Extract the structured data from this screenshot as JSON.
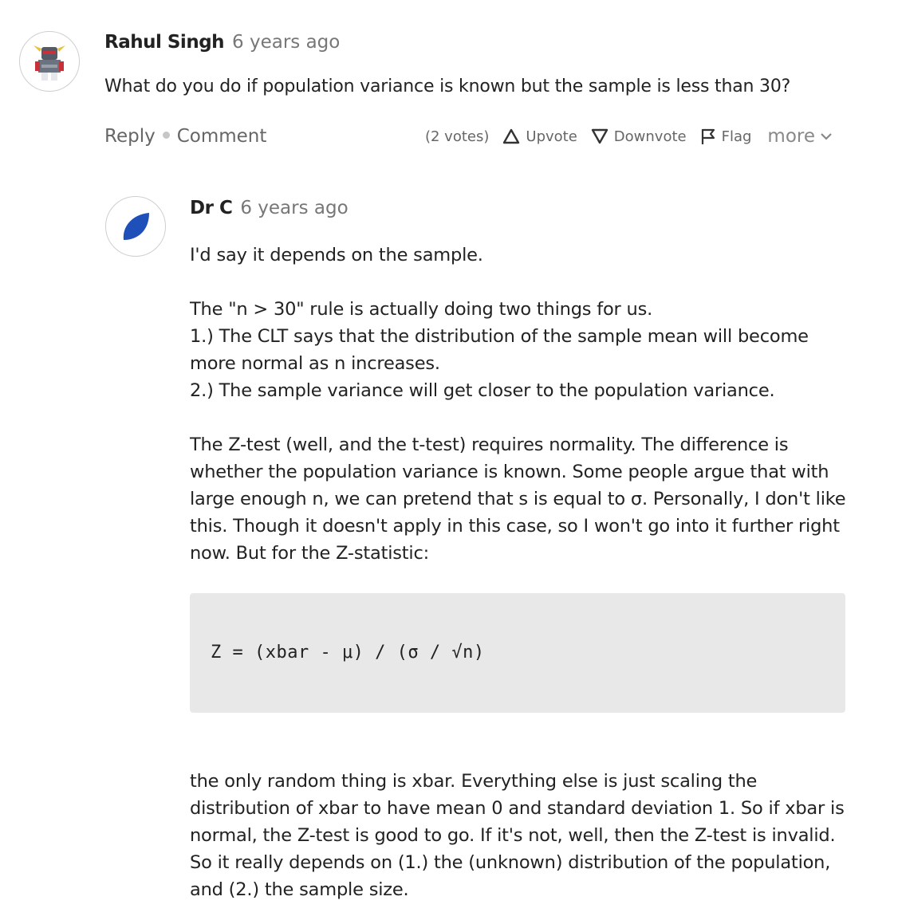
{
  "thread": {
    "comment": {
      "author": "Rahul Singh",
      "time": "6 years ago",
      "avatar_icon": "robot-avatar-icon",
      "text": "What do you do if population variance is known but the sample is less than 30?",
      "actions": {
        "reply": "Reply",
        "comment": "Comment",
        "votes": "(2 votes)",
        "upvote": "Upvote",
        "downvote": "Downvote",
        "flag": "Flag",
        "more": "more"
      }
    },
    "reply": {
      "author": "Dr C",
      "time": "6 years ago",
      "avatar_icon": "leaf-icon",
      "paragraphs": [
        "I'd say it depends on the sample.",
        "The \"n > 30\" rule is actually doing two things for us.\n1.) The CLT says that the distribution of the sample mean will become more normal as n increases.\n2.) The sample variance will get closer to the population variance.",
        "The Z-test (well, and the t-test) requires normality. The difference is whether the population variance is known. Some people argue that with large enough n, we can pretend that s is equal to σ. Personally, I don't like this. Though it doesn't apply in this case, so I won't go into it further right now. But for the Z-statistic:"
      ],
      "code": "Z = (xbar - μ) / (σ / √n)",
      "closing": "the only random thing is xbar. Everything else is just scaling the distribution of xbar to have mean 0 and standard deviation 1. So if xbar is normal, the Z-test is good to go. If it's not, well, then the Z-test is invalid. So it really depends on (1.) the (unknown) distribution of the population, and (2.) the sample size."
    }
  },
  "colors": {
    "text": "#222222",
    "muted": "#777777",
    "code_bg": "#e8e8e8",
    "leaf": "#1f4fb8"
  }
}
